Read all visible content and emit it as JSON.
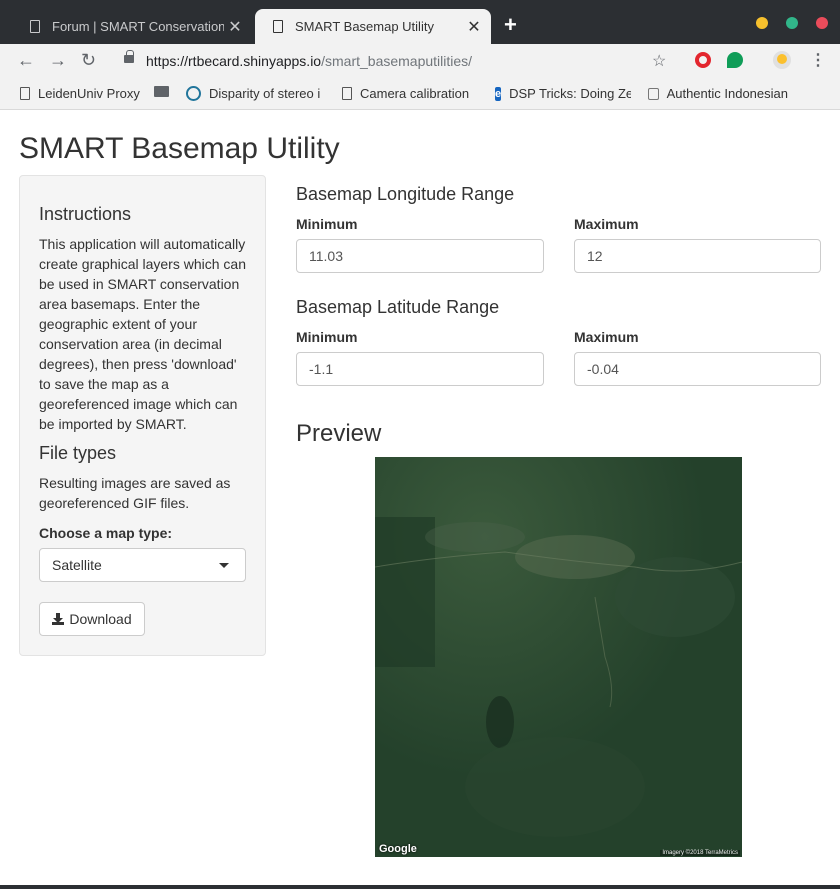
{
  "browser": {
    "tabs": [
      {
        "title": "Forum | SMART Conservation S"
      },
      {
        "title": "SMART Basemap Utility"
      }
    ],
    "url_host": "https://rtbecard.shinyapps.io",
    "url_path": "/smart_basemaputilities/",
    "bookmarks": [
      {
        "label": "LeidenUniv Proxy",
        "icon": "doc-icon"
      },
      {
        "label": "",
        "icon": "folder-icon"
      },
      {
        "label": "Disparity of stereo i",
        "icon": "wordpress-icon"
      },
      {
        "label": "Camera calibration",
        "icon": "doc-icon"
      },
      {
        "label": "DSP Tricks: Doing Ze",
        "icon": "e-icon"
      },
      {
        "label": "Authentic Indonesian",
        "icon": "gallery-icon"
      }
    ],
    "window_colors": {
      "minimize": "#f6c02d",
      "maximize": "#31b68a",
      "close": "#ea4c5b"
    }
  },
  "page": {
    "title": "SMART Basemap Utility",
    "sidebar": {
      "instructions_heading": "Instructions",
      "instructions_text": "This application will automatically create graphical layers which can be used in SMART conservation area basemaps. Enter the geographic extent of your conservation area (in decimal degrees), then press 'download' to save the map as a georeferenced image which can be imported by SMART.",
      "filetypes_heading": "File types",
      "filetypes_text": "Resulting images are saved as georeferenced GIF files.",
      "map_type_label": "Choose a map type:",
      "map_type_value": "Satellite",
      "download_label": "Download"
    },
    "longitude": {
      "heading": "Basemap Longitude Range",
      "min_label": "Minimum",
      "min_value": "11.03",
      "max_label": "Maximum",
      "max_value": "12"
    },
    "latitude": {
      "heading": "Basemap Latitude Range",
      "min_label": "Minimum",
      "min_value": "-1.1",
      "max_label": "Maximum",
      "max_value": "-0.04"
    },
    "preview_heading": "Preview",
    "map_logo": "Google",
    "map_attribution": "Imagery ©2018 TerraMetrics"
  }
}
